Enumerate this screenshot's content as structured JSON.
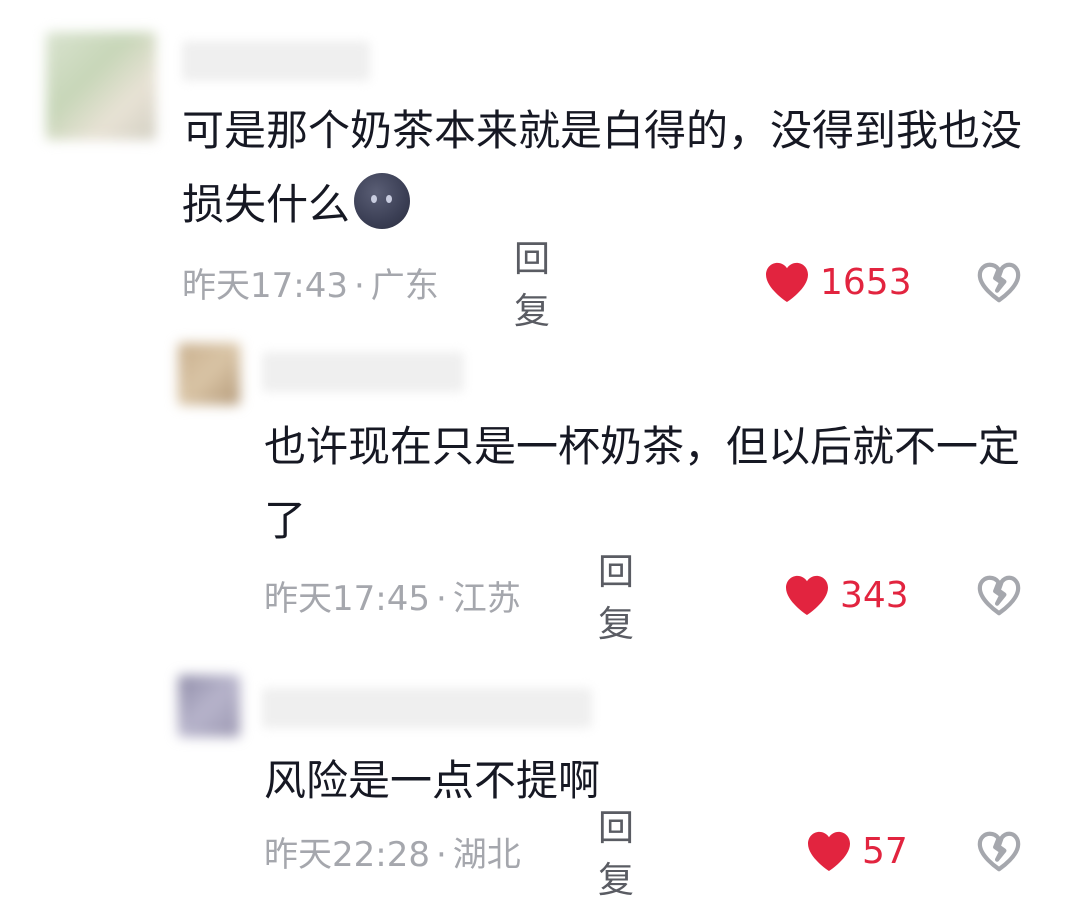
{
  "comments": [
    {
      "text": "可是那个奶茶本来就是白得的，没得到我也没损失什么",
      "emoji": "new-moon-face",
      "time": "昨天17:43",
      "location": "广东",
      "reply_label": "回复",
      "likes": "1653"
    },
    {
      "text": "也许现在只是一杯奶茶，但以后就不一定了",
      "time": "昨天17:45",
      "location": "江苏",
      "reply_label": "回复",
      "likes": "343"
    },
    {
      "text": "风险是一点不提啊",
      "time": "昨天22:28",
      "location": "湖北",
      "reply_label": "回复",
      "likes": "57"
    }
  ],
  "meta_separator": "·",
  "colors": {
    "like": "#e2243f",
    "meta": "#a5a7ad",
    "text": "#161823",
    "dislike": "#a5a7ad"
  },
  "icons": {
    "like": "heart-icon",
    "dislike": "broken-heart-icon"
  }
}
